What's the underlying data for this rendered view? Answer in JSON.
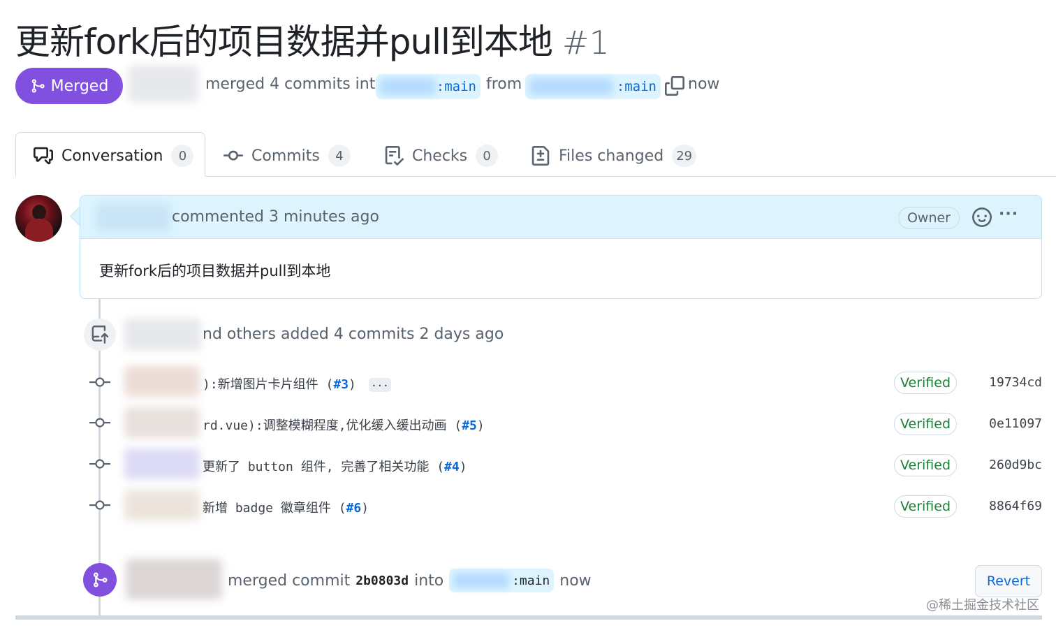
{
  "pr": {
    "title": "更新fork后的项目数据并pull到本地",
    "number": "#1",
    "status": "Merged",
    "summary_text": "merged 4 commits into",
    "base_branch_suffix": ":main",
    "from_text": "from",
    "head_branch_suffix": ":main",
    "time": "now"
  },
  "tabs": [
    {
      "label": "Conversation",
      "count": "0"
    },
    {
      "label": "Commits",
      "count": "4"
    },
    {
      "label": "Checks",
      "count": "0"
    },
    {
      "label": "Files changed",
      "count": "29"
    }
  ],
  "comment": {
    "meta": "commented 3 minutes ago",
    "role": "Owner",
    "more": "···",
    "body": "更新fork后的项目数据并pull到本地"
  },
  "commits_event": {
    "text": "nd others added 4 commits 2 days ago",
    "commits": [
      {
        "msg": "):新增图片卡片组件 (",
        "ref": "#3",
        "close": ")",
        "more": "...",
        "verified": "Verified",
        "sha": "19734cd"
      },
      {
        "msg": "rd.vue):调整模糊程度,优化缓入缓出动画 (",
        "ref": "#5",
        "close": ")",
        "verified": "Verified",
        "sha": "0e11097"
      },
      {
        "msg": "更新了 button 组件, 完善了相关功能 (",
        "ref": "#4",
        "close": ")",
        "verified": "Verified",
        "sha": "260d9bc"
      },
      {
        "msg": "新增 badge 徽章组件 (",
        "ref": "#6",
        "close": ")",
        "verified": "Verified",
        "sha": "8864f69"
      }
    ]
  },
  "merge_event": {
    "prefix": "merged commit",
    "sha": "2b0803d",
    "into": "into",
    "branch_suffix": ":main",
    "time": "now",
    "revert": "Revert"
  },
  "watermark": "@稀土掘金技术社区",
  "colors": {
    "merged_purple": "#8250df",
    "link_blue": "#0969da",
    "verified_green": "#1a7f37",
    "comment_header_bg": "#ddf4ff"
  }
}
